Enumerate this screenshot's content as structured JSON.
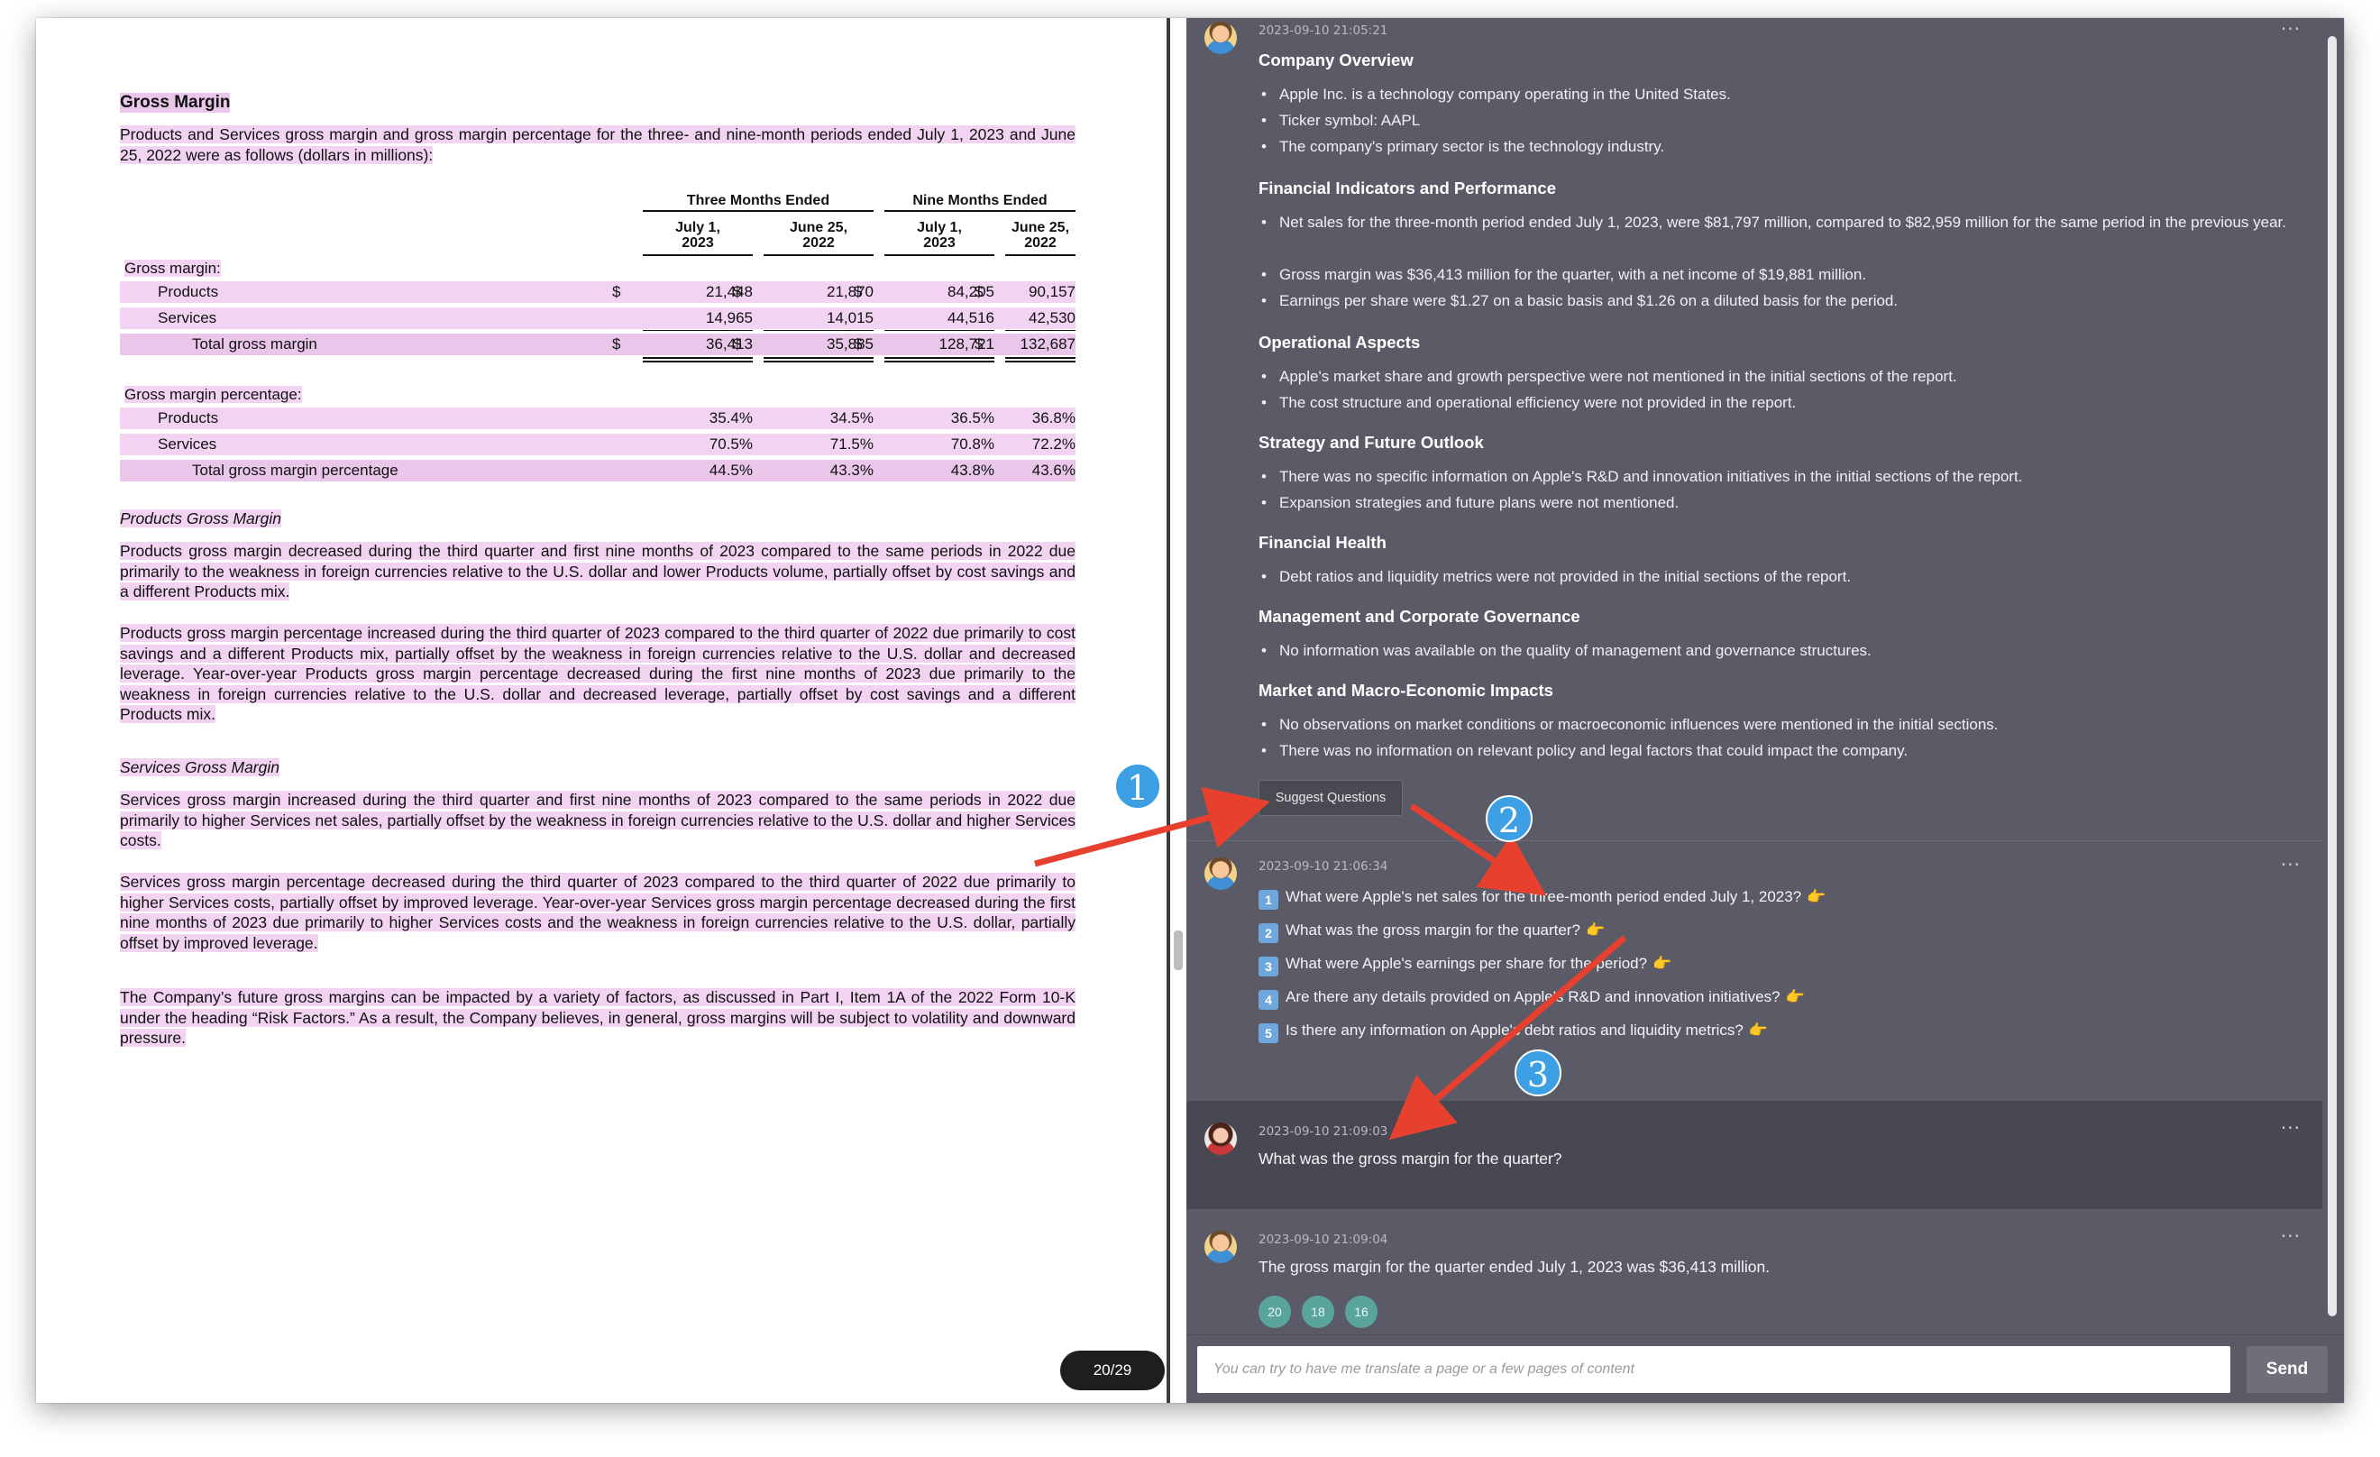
{
  "pdf": {
    "section_title": "Gross Margin",
    "intro": "Products and Services gross margin and gross margin percentage for the three- and nine-month periods ended July 1, 2023 and June 25, 2022 were as follows (dollars in millions):",
    "table": {
      "group_headers": [
        "Three Months Ended",
        "Nine Months Ended"
      ],
      "col_headers": [
        "July 1,\n2023",
        "June 25,\n2022",
        "July 1,\n2023",
        "June 25,\n2022"
      ],
      "section1": "Gross margin:",
      "rows1": [
        {
          "label": "Products",
          "values": [
            "21,448",
            "21,870",
            "84,205",
            "90,157"
          ],
          "dollar": true
        },
        {
          "label": "Services",
          "values": [
            "14,965",
            "14,015",
            "44,516",
            "42,530"
          ],
          "dollar": false
        },
        {
          "label": "Total gross margin",
          "values": [
            "36,413",
            "35,885",
            "128,721",
            "132,687"
          ],
          "dollar": true
        }
      ],
      "section2": "Gross margin percentage:",
      "rows2": [
        {
          "label": "Products",
          "values": [
            "35.4%",
            "34.5%",
            "36.5%",
            "36.8%"
          ]
        },
        {
          "label": "Services",
          "values": [
            "70.5%",
            "71.5%",
            "70.8%",
            "72.2%"
          ]
        },
        {
          "label": "Total gross margin percentage",
          "values": [
            "44.5%",
            "43.3%",
            "43.8%",
            "43.6%"
          ]
        }
      ],
      "dollar_sign": "$"
    },
    "products_heading": "Products Gross Margin",
    "products_p1": "Products gross margin decreased during the third quarter and first nine months of 2023 compared to the same periods in 2022 due primarily to the weakness in foreign currencies relative to the U.S. dollar and lower Products volume, partially offset by cost savings and a different Products mix.",
    "products_p2": "Products gross margin percentage increased during the third quarter of 2023 compared to the third quarter of 2022 due primarily to cost savings and a different Products mix, partially offset by the weakness in foreign currencies relative to the U.S. dollar and decreased leverage. Year-over-year Products gross margin percentage decreased during the first nine months of 2023 due primarily to the weakness in foreign currencies relative to the U.S. dollar and decreased leverage, partially offset by cost savings and a different Products mix.",
    "services_heading": "Services Gross Margin",
    "services_p1": "Services gross margin increased during the third quarter and first nine months of 2023 compared to the same periods in 2022 due primarily to higher Services net sales, partially offset by the weakness in foreign currencies relative to the U.S. dollar and higher Services costs.",
    "services_p2": "Services gross margin percentage decreased during the third quarter of 2023 compared to the third quarter of 2022 due primarily to higher Services costs, partially offset by improved leverage. Year-over-year Services gross margin percentage decreased during the first nine months of 2023 due primarily to higher Services costs and the weakness in foreign currencies relative to the U.S. dollar, partially offset by improved leverage.",
    "closing": "The Company’s future gross margins can be impacted by a variety of factors, as discussed in Part I, Item 1A of the 2022 Form 10-K under the heading “Risk Factors.” As a result, the Company believes, in general, gross margins will be subject to volatility and downward pressure.",
    "page_indicator": "20/29"
  },
  "chat": {
    "msg1": {
      "timestamp": "2023-09-10 21:05:21",
      "sections": [
        {
          "heading": "Company Overview",
          "items": [
            "Apple Inc. is a technology company operating in the United States.",
            "Ticker symbol: AAPL",
            "The company's primary sector is the technology industry."
          ]
        },
        {
          "heading": "Financial Indicators and Performance",
          "items": [
            "Net sales for the three-month period ended July 1, 2023, were $81,797 million, compared to $82,959 million for the same period in the previous year.",
            "Gross margin was $36,413 million for the quarter, with a net income of $19,881 million.",
            "Earnings per share were $1.27 on a basic basis and $1.26 on a diluted basis for the period."
          ]
        },
        {
          "heading": "Operational Aspects",
          "items": [
            "Apple's market share and growth perspective were not mentioned in the initial sections of the report.",
            "The cost structure and operational efficiency were not provided in the report."
          ]
        },
        {
          "heading": "Strategy and Future Outlook",
          "items": [
            "There was no specific information on Apple's R&D and innovation initiatives in the initial sections of the report.",
            "Expansion strategies and future plans were not mentioned."
          ]
        },
        {
          "heading": "Financial Health",
          "items": [
            "Debt ratios and liquidity metrics were not provided in the initial sections of the report."
          ]
        },
        {
          "heading": "Management and Corporate Governance",
          "items": [
            "No information was available on the quality of management and governance structures."
          ]
        },
        {
          "heading": "Market and Macro-Economic Impacts",
          "items": [
            "No observations on market conditions or macroeconomic influences were mentioned in the initial sections.",
            "There was no information on relevant policy and legal factors that could impact the company."
          ]
        }
      ],
      "suggest_button": "Suggest Questions"
    },
    "msg2": {
      "timestamp": "2023-09-10 21:06:34",
      "questions": [
        {
          "num": "1",
          "text": "What were Apple's net sales for the three-month period ended July 1, 2023?"
        },
        {
          "num": "2",
          "text": "What was the gross margin for the quarter?"
        },
        {
          "num": "3",
          "text": "What were Apple's earnings per share for the period?"
        },
        {
          "num": "4",
          "text": "Are there any details provided on Apple's R&D and innovation initiatives?"
        },
        {
          "num": "5",
          "text": "Is there any information on Apple's debt ratios and liquidity metrics?"
        }
      ],
      "pointer": "👉"
    },
    "msg3": {
      "timestamp": "2023-09-10 21:09:03",
      "text": "What was the gross margin for the quarter?"
    },
    "msg4": {
      "timestamp": "2023-09-10 21:09:04",
      "text": "The gross margin for the quarter ended July 1, 2023 was $36,413 million.",
      "chips": [
        "20",
        "18",
        "16"
      ]
    },
    "more": "···",
    "input_placeholder": "You can try to have me translate a page or a few pages of content",
    "send_label": "Send"
  },
  "annotations": {
    "badges": [
      "1",
      "2",
      "3"
    ],
    "arrow_color": "#e8402f",
    "badge_color": "#3d9fe4"
  }
}
